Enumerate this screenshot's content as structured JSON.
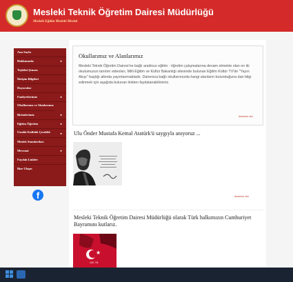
{
  "header": {
    "title": "Mesleki Teknik Öğretim Dairesi Müdürlüğü",
    "subtitle": "Mesleki Eğitim Mesleki Meslek",
    "bg_color": "#d42a2a"
  },
  "sidebar": {
    "bg_color": "#8b1a1a",
    "items": [
      {
        "label": "Ana Sayfa"
      },
      {
        "label": "Hakkımızda",
        "has_submenu": true
      },
      {
        "label": "Teşkilat Şeması"
      },
      {
        "label": "İletişim Bilgileri"
      },
      {
        "label": "Duyurular"
      },
      {
        "label": "Faaliyetlerimiz",
        "has_submenu": true
      },
      {
        "label": "Okullarımız ve Alanlarımız"
      },
      {
        "label": "Birimlerimiz",
        "has_submenu": true
      },
      {
        "label": "Eğitim Öğretim",
        "has_submenu": true
      },
      {
        "label": "Ustalık Kalfalık Çıraklık",
        "has_submenu": true
      },
      {
        "label": "Meslek Standartları"
      },
      {
        "label": "Mevzuat",
        "has_submenu": true
      },
      {
        "label": "Faydalı Linkler"
      },
      {
        "label": "Bize Ulaşın"
      }
    ],
    "submenu_icon": "chevron-right-icon",
    "facebook_icon": "facebook-icon"
  },
  "main": {
    "box": {
      "title": "Okullarımız ve Alanlarımız",
      "text": "Mesleki Teknik Öğretim Dairesi'ne bağlı aralıksız eğitim - öğretim çalışmalarına devam etmekte olan on iki okulumuzun tanıtım videoları, Milli Eğitim ve Kültür Bakanlığı sitesinde bulunan Eğitim Kültür TV'de \"Yayın Akışı\" başlığı altında yayınlanmaktadır. Daireniza bağlı okullarımızda hangi alanların bulunduğuna dair bilgi edinmek için aşağıda bulunan linkten faydalanabilirsiniz.",
      "more": "devamını oku"
    },
    "posts": [
      {
        "title": "Ulu Önder Mustafa Kemal Atatürk'ü saygıyla anıyoruz ...",
        "more": "devamını oku"
      },
      {
        "title": "Mesleki Teknik Öğretim Dairesi Müdürlüğü olarak Türk halkımızın Cumhuriyet Bayramını kutlarız.",
        "image_caption": "100. YIL"
      }
    ]
  },
  "taskbar": {
    "bg_color": "#1a2331",
    "icons": [
      "windows-icon",
      "app-icon"
    ]
  }
}
